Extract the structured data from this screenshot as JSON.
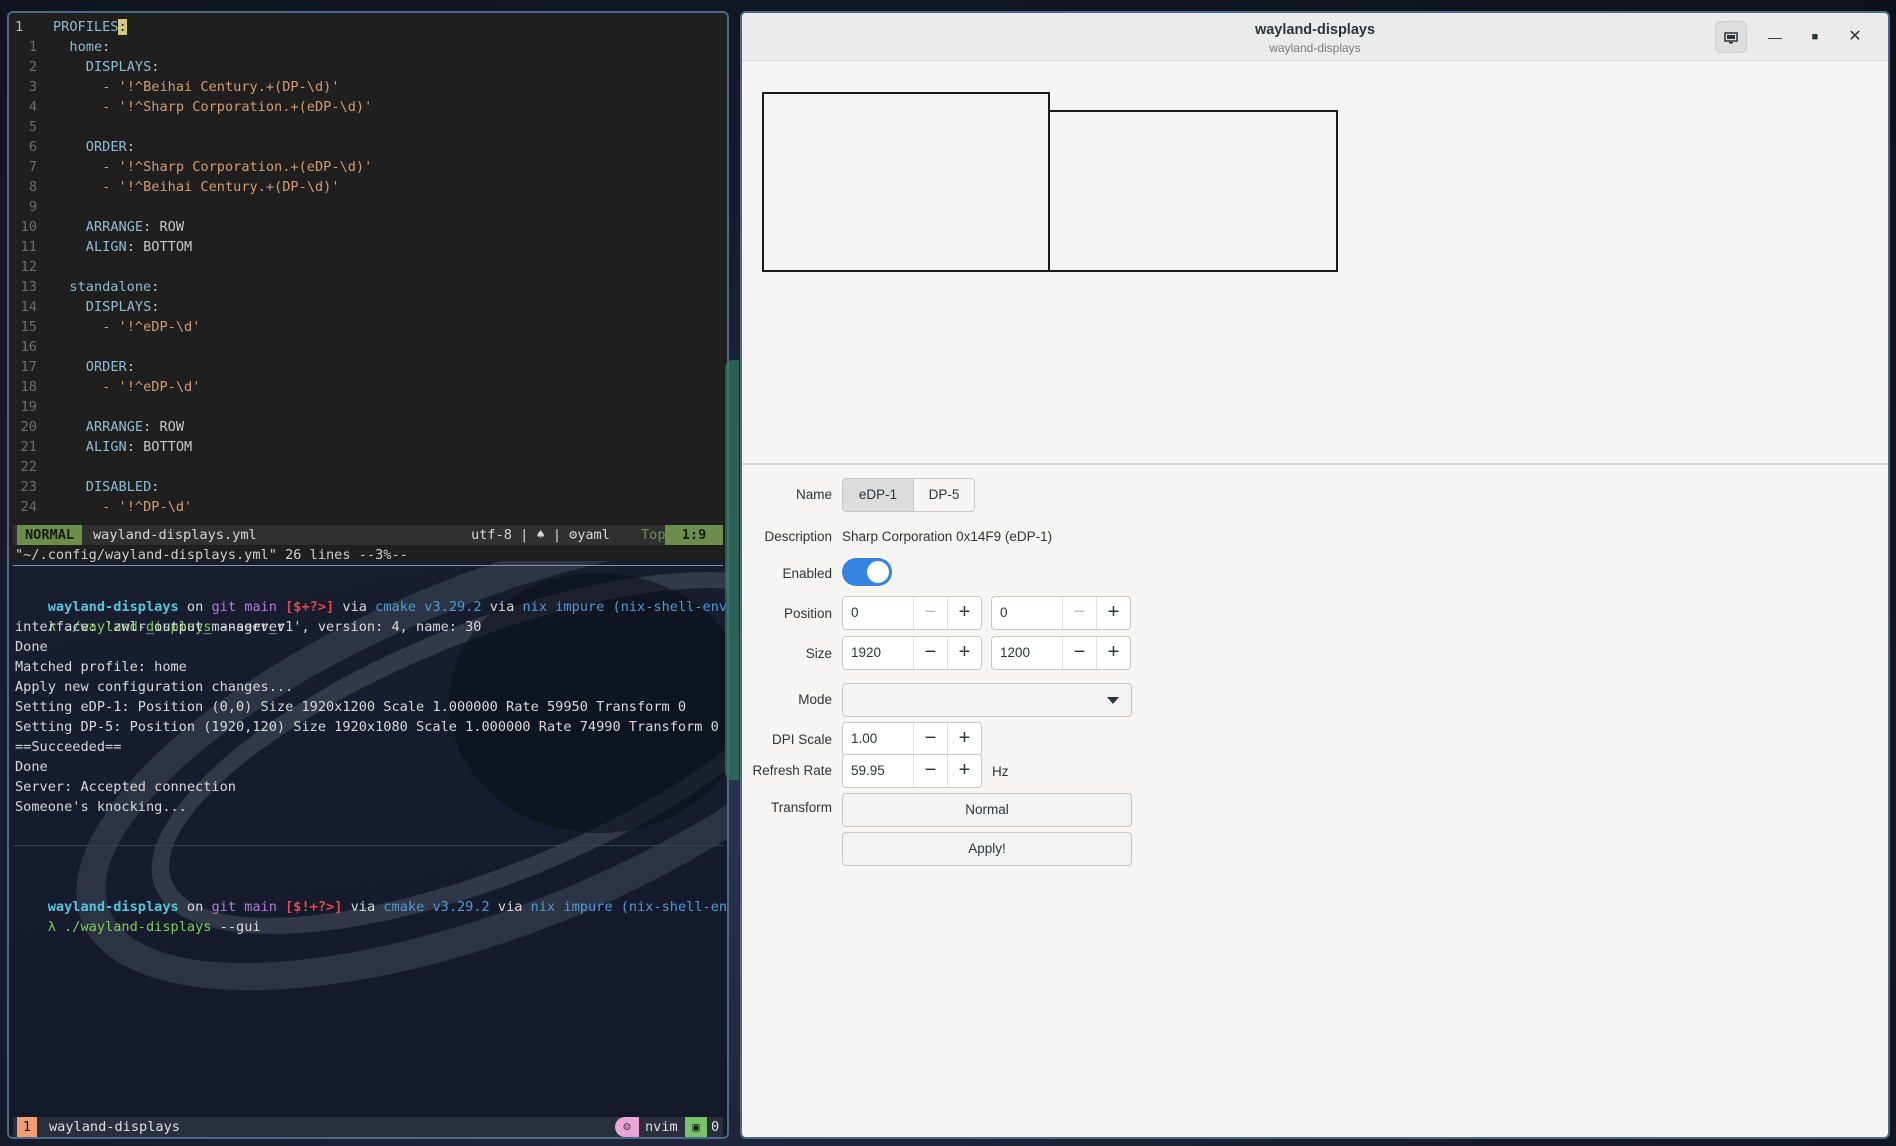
{
  "editor": {
    "lines": [
      {
        "n": "1",
        "indent": 0,
        "key": "PROFILES",
        "text": "",
        "cursor": true
      },
      {
        "n": "1",
        "indent": 1,
        "key": "home",
        "text": ""
      },
      {
        "n": "2",
        "indent": 2,
        "key": "DISPLAYS",
        "text": ""
      },
      {
        "n": "3",
        "indent": 3,
        "key": "",
        "text": "- '!^Beihai Century.+(DP-\\d)'"
      },
      {
        "n": "4",
        "indent": 3,
        "key": "",
        "text": "- '!^Sharp Corporation.+(eDP-\\d)'"
      },
      {
        "n": "5",
        "indent": 0,
        "key": "",
        "text": ""
      },
      {
        "n": "6",
        "indent": 2,
        "key": "ORDER",
        "text": ""
      },
      {
        "n": "7",
        "indent": 3,
        "key": "",
        "text": "- '!^Sharp Corporation.+(eDP-\\d)'"
      },
      {
        "n": "8",
        "indent": 3,
        "key": "",
        "text": "- '!^Beihai Century.+(DP-\\d)'"
      },
      {
        "n": "9",
        "indent": 0,
        "key": "",
        "text": ""
      },
      {
        "n": "10",
        "indent": 2,
        "key": "ARRANGE",
        "text": "ROW"
      },
      {
        "n": "11",
        "indent": 2,
        "key": "ALIGN",
        "text": "BOTTOM"
      },
      {
        "n": "12",
        "indent": 0,
        "key": "",
        "text": ""
      },
      {
        "n": "13",
        "indent": 1,
        "key": "standalone",
        "text": ""
      },
      {
        "n": "14",
        "indent": 2,
        "key": "DISPLAYS",
        "text": ""
      },
      {
        "n": "15",
        "indent": 3,
        "key": "",
        "text": "- '!^eDP-\\d'"
      },
      {
        "n": "16",
        "indent": 0,
        "key": "",
        "text": ""
      },
      {
        "n": "17",
        "indent": 2,
        "key": "ORDER",
        "text": ""
      },
      {
        "n": "18",
        "indent": 3,
        "key": "",
        "text": "- '!^eDP-\\d'"
      },
      {
        "n": "19",
        "indent": 0,
        "key": "",
        "text": ""
      },
      {
        "n": "20",
        "indent": 2,
        "key": "ARRANGE",
        "text": "ROW"
      },
      {
        "n": "21",
        "indent": 2,
        "key": "ALIGN",
        "text": "BOTTOM"
      },
      {
        "n": "22",
        "indent": 0,
        "key": "",
        "text": ""
      },
      {
        "n": "23",
        "indent": 2,
        "key": "DISABLED",
        "text": ""
      },
      {
        "n": "24",
        "indent": 3,
        "key": "",
        "text": "- '!^DP-\\d'"
      }
    ],
    "status": {
      "mode": "NORMAL",
      "filename": "wayland-displays.yml",
      "encoding": "utf-8 | ",
      "os_glyph": "♠",
      "filetype": "yaml",
      "scroll": "Top",
      "position": "1:9"
    },
    "cmdline": "\"~/.config/wayland-displays.yml\" 26 lines --3%--"
  },
  "terminal": {
    "prompt1": {
      "dir": "wayland-displays",
      "on": " on ",
      "branch_icon_text": "git main",
      "status": " [$+?>]",
      "via1": " via ",
      "cmake": "cmake v3.29.2",
      "via2": " via ",
      "nix": "nix impure (nix-shell-env)"
    },
    "cmd1": {
      "lambda": "λ ",
      "exe": "./wayland-displays",
      "args": " --server"
    },
    "output": [
      "interface: 'zwlr_output_manager_v1', version: 4, name: 30",
      "Done",
      "Matched profile: home",
      "Apply new configuration changes...",
      "Setting eDP-1: Position (0,0) Size 1920x1200 Scale 1.000000 Rate 59950 Transform 0",
      "Setting DP-5: Position (1920,120) Size 1920x1080 Scale 1.000000 Rate 74990 Transform 0",
      "==Succeeded==",
      "Done",
      "Server: Accepted connection",
      "Someone's knocking..."
    ],
    "prompt2": {
      "dir": "wayland-displays",
      "on": " on ",
      "branch_icon_text": "git main",
      "status": " [$!+?>]",
      "via1": " via ",
      "cmake": "cmake v3.29.2",
      "via2": " via ",
      "nix": "nix impure (nix-shell-env)"
    },
    "cmd2": {
      "lambda": "λ ",
      "exe": "./wayland-displays",
      "args": " --gui"
    }
  },
  "tmux": {
    "window_index": "1",
    "window_name": "wayland-displays",
    "process": "nvim",
    "pane_count": "0"
  },
  "gui": {
    "title": "wayland-displays",
    "subtitle": "wayland-displays",
    "labels": {
      "name": "Name",
      "description": "Description",
      "enabled": "Enabled",
      "position": "Position",
      "size": "Size",
      "mode": "Mode",
      "dpi_scale": "DPI Scale",
      "refresh_rate": "Refresh Rate",
      "transform": "Transform"
    },
    "name_tabs": [
      "eDP-1",
      "DP-5"
    ],
    "selected_tab": "eDP-1",
    "description": "Sharp Corporation 0x14F9  (eDP-1)",
    "enabled": true,
    "position_x": "0",
    "position_y": "0",
    "size_w": "1920",
    "size_h": "1200",
    "mode_value": "",
    "dpi_scale": "1.00",
    "refresh_rate": "59.95",
    "refresh_unit": "Hz",
    "transform": "Normal",
    "apply_label": "Apply!"
  }
}
